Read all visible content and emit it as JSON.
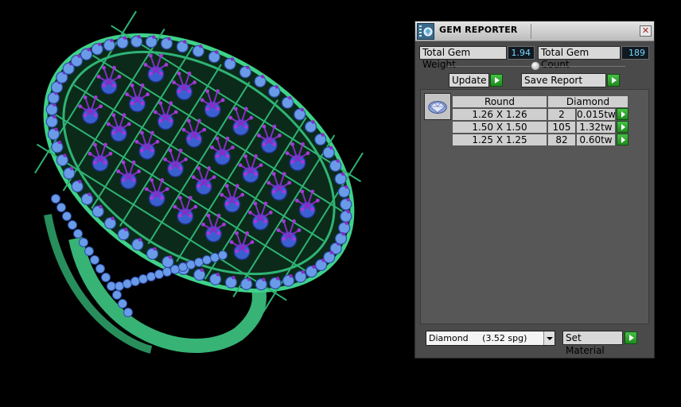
{
  "window": {
    "title": "GEM REPORTER",
    "close_glyph": "✕",
    "icon": "gem-reporter-app-icon"
  },
  "stats": {
    "weight_label": "Total Gem Weight",
    "weight_value": "1.94",
    "count_label": "Total Gem Count",
    "count_value": "189"
  },
  "toolbar": {
    "update_label": "Update",
    "save_label": "Save Report"
  },
  "report": {
    "headers": [
      "Round",
      "Diamond"
    ],
    "rows": [
      {
        "size": "1.26 X 1.26",
        "count": "2",
        "weight": "0.015tw"
      },
      {
        "size": "1.50 X 1.50",
        "count": "105",
        "weight": "1.32tw"
      },
      {
        "size": "1.25 X 1.25",
        "count": "82",
        "weight": "0.60tw"
      }
    ]
  },
  "material": {
    "selected": "Diamond     (3.52 spg)",
    "set_label": "Set Material"
  },
  "colors": {
    "panel_bg": "#4a4a4a",
    "accent_green": "#2faa2f",
    "value_text": "#7ad7ff",
    "gem_blue": "#3a5fd0",
    "prong_purple": "#8a2bc8",
    "metal_green": "#3fd28a"
  }
}
